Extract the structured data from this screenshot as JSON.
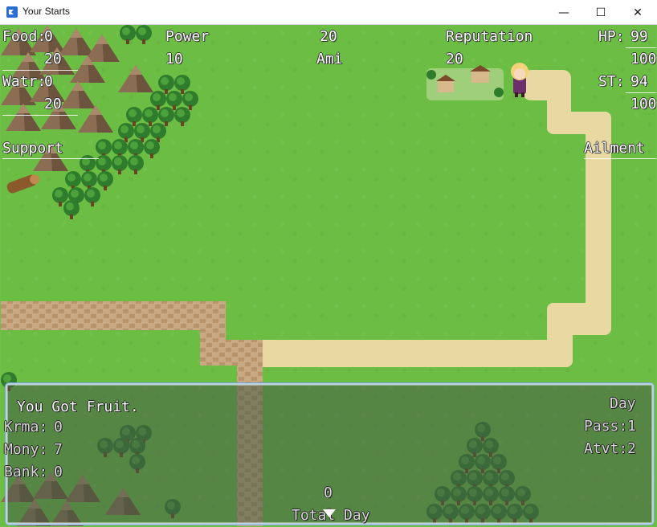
{
  "window": {
    "title": "Your Starts",
    "minimize": "—",
    "maximize": "☐",
    "close": "✕"
  },
  "hud": {
    "food_label": "Food:",
    "food_value": "0",
    "food_max": "20",
    "water_label": "Watr:",
    "water_value": "0",
    "water_max": "20",
    "power_label": "Power",
    "power_value": "10",
    "center_value": "20",
    "ami_label": "Ami",
    "reputation_label": "Reputation",
    "reputation_value": "20",
    "hp_label": "HP:",
    "hp_value": "99",
    "hp_max": "100",
    "st_label": "ST:",
    "st_value": "94",
    "st_max": "100",
    "support_label": "Support",
    "ailment_label": "Ailment"
  },
  "message": {
    "text": "You Got Fruit.",
    "karma_label": "Krma:",
    "karma_value": "0",
    "money_label": "Mony:",
    "money_value": "7",
    "bank_label": "Bank:",
    "bank_value": "0",
    "day_label": "Day",
    "pass_label": "Pass:",
    "pass_value": "1",
    "activity_label": "Atvt:",
    "activity_value": "2",
    "total_value": "0",
    "total_label": "Total Day"
  }
}
